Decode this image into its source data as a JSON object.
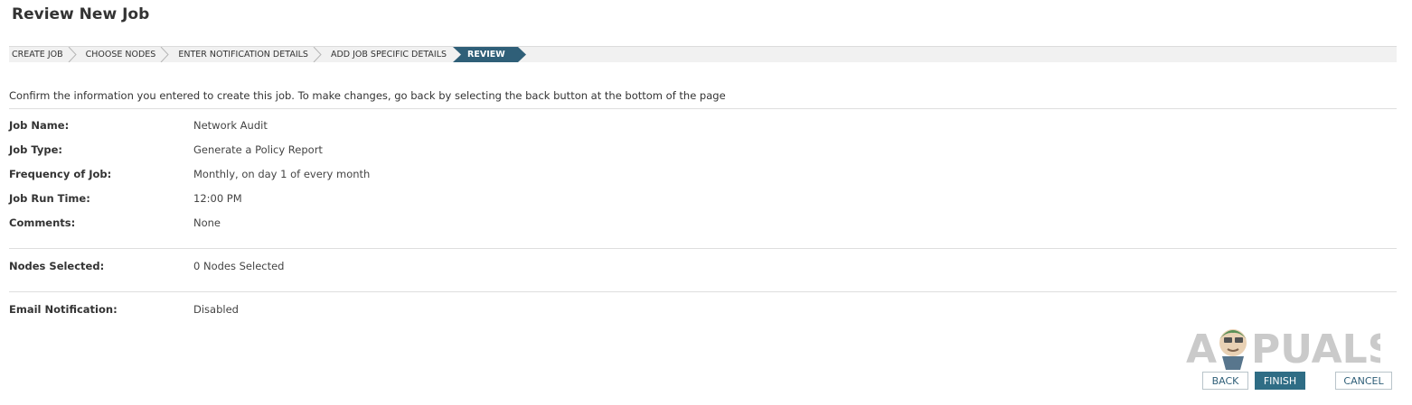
{
  "header": {
    "title": "Review New Job"
  },
  "wizard": {
    "steps": [
      {
        "label": "CREATE JOB",
        "active": false
      },
      {
        "label": "CHOOSE NODES",
        "active": false
      },
      {
        "label": "ENTER NOTIFICATION DETAILS",
        "active": false
      },
      {
        "label": "ADD JOB SPECIFIC DETAILS",
        "active": false
      },
      {
        "label": "REVIEW",
        "active": true
      }
    ]
  },
  "intro": "Confirm the information you entered to create this job. To make changes, go back by selecting the back button at the bottom of the page",
  "details": {
    "job_name": {
      "label": "Job Name:",
      "value": "Network Audit"
    },
    "job_type": {
      "label": "Job Type:",
      "value": "Generate a Policy Report"
    },
    "frequency": {
      "label": "Frequency of Job:",
      "value": "Monthly, on day 1 of every month"
    },
    "run_time": {
      "label": "Job Run Time:",
      "value": "12:00 PM"
    },
    "comments": {
      "label": "Comments:",
      "value": "None"
    },
    "nodes": {
      "label": "Nodes Selected:",
      "value": "0 Nodes Selected"
    },
    "email": {
      "label": "Email Notification:",
      "value": "Disabled"
    }
  },
  "buttons": {
    "back": "BACK",
    "finish": "FINISH",
    "cancel": "CANCEL"
  },
  "watermark": {
    "text": "APPUALS"
  },
  "colors": {
    "accent": "#2f5f78",
    "button_primary": "#2f6d85",
    "step_bar": "#f1f1f1"
  }
}
